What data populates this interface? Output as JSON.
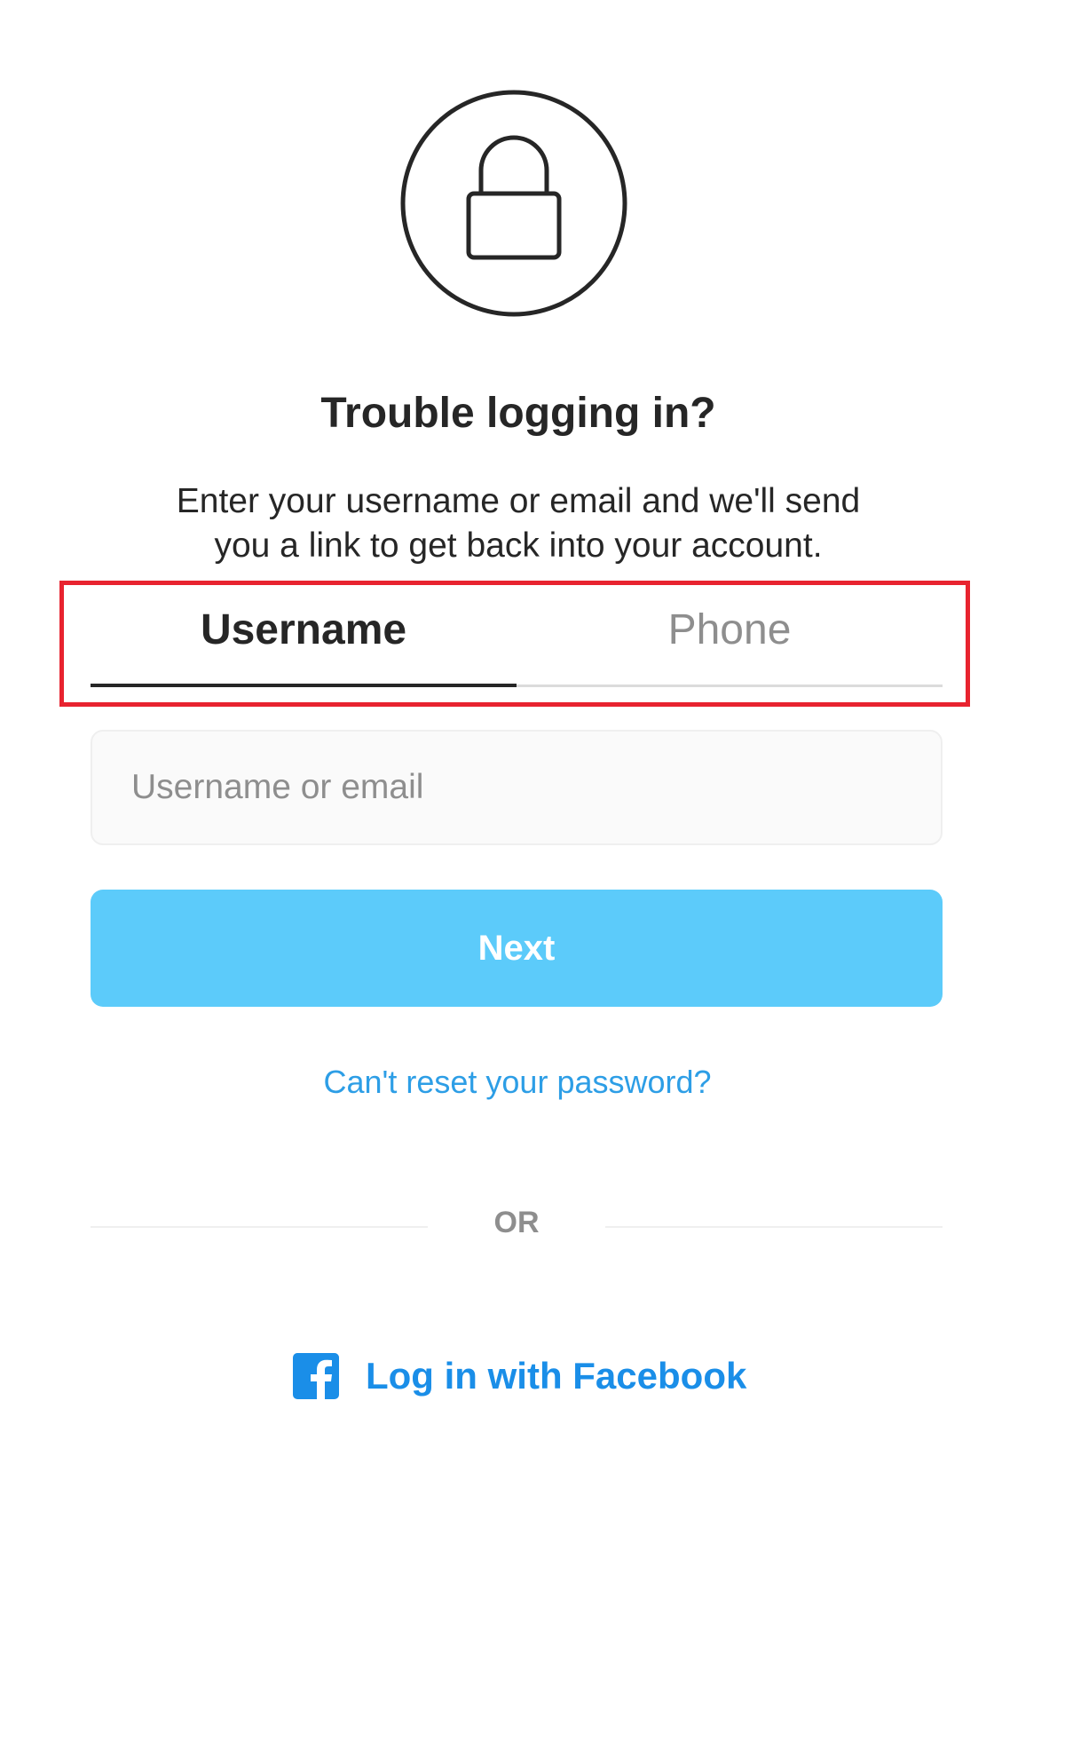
{
  "header": {
    "icon": "lock-icon",
    "title": "Trouble logging in?",
    "description_line1": "Enter your username or email and we'll send",
    "description_line2": "you a link to get back into your account."
  },
  "tabs": [
    {
      "label": "Username",
      "active": true
    },
    {
      "label": "Phone",
      "active": false
    }
  ],
  "form": {
    "input_placeholder": "Username or email",
    "input_value": "",
    "next_label": "Next"
  },
  "links": {
    "reset_label": "Can't reset your password?"
  },
  "divider": {
    "label": "OR"
  },
  "facebook": {
    "icon": "facebook-icon",
    "label": "Log in with Facebook"
  },
  "colors": {
    "highlight_box": "#e8232f",
    "next_button": "#5ccbfa",
    "link": "#2d9ee6",
    "facebook_blue": "#1a8ee8"
  }
}
